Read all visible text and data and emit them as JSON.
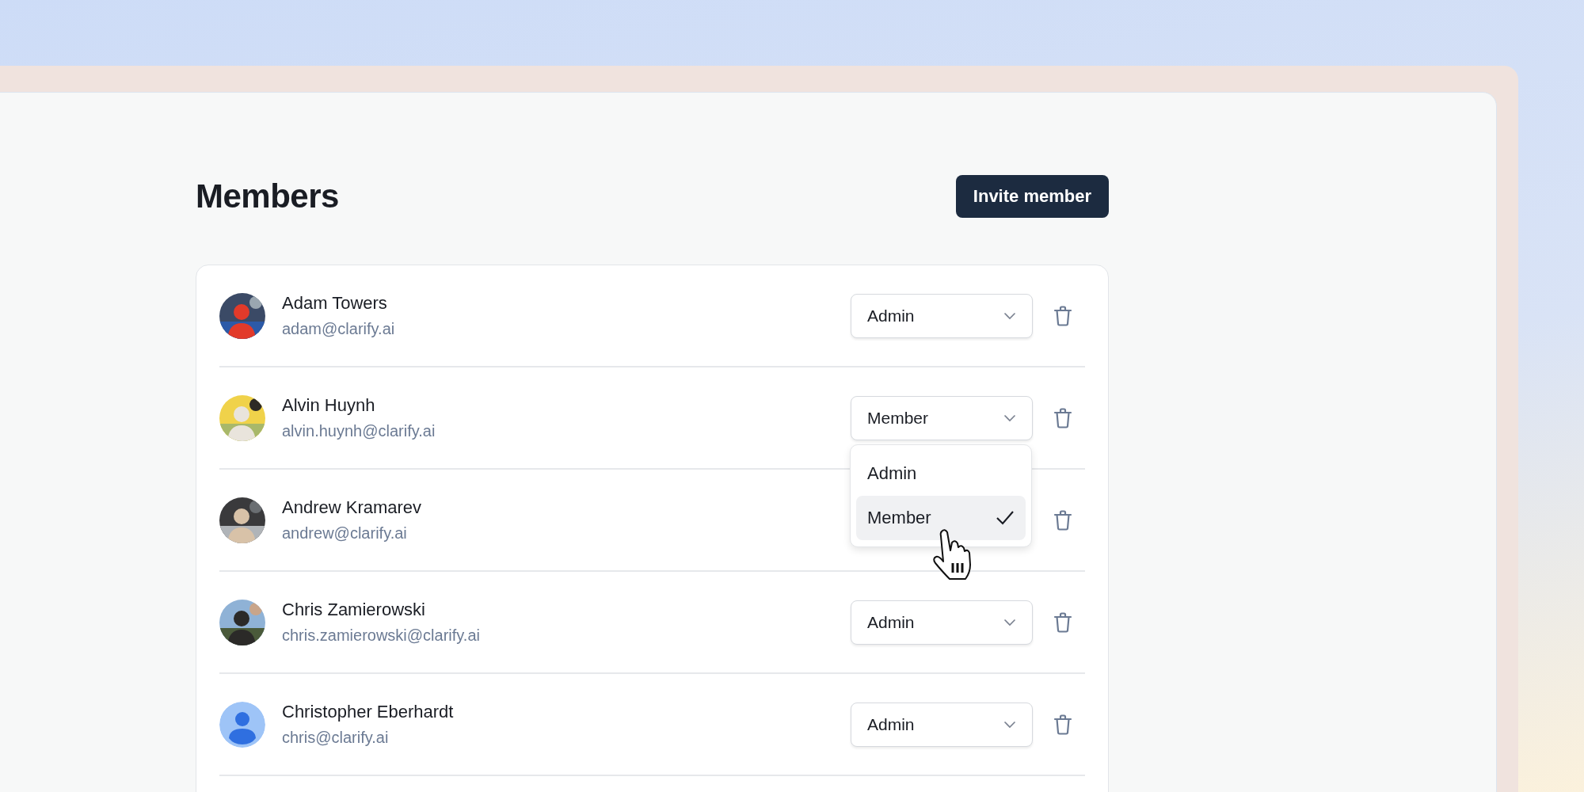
{
  "page": {
    "title": "Members",
    "invite_button": "Invite member"
  },
  "members": [
    {
      "name": "Adam Towers",
      "email": "adam@clarify.ai",
      "role": "Admin"
    },
    {
      "name": "Alvin Huynh",
      "email": "alvin.huynh@clarify.ai",
      "role": "Member",
      "menu": {
        "options": [
          {
            "label": "Admin",
            "selected": false
          },
          {
            "label": "Member",
            "selected": true
          }
        ]
      }
    },
    {
      "name": "Andrew Kramarev",
      "email": "andrew@clarify.ai"
    },
    {
      "name": "Chris Zamierowski",
      "email": "chris.zamierowski@clarify.ai",
      "role": "Admin"
    },
    {
      "name": "Christopher Eberhardt",
      "email": "chris@clarify.ai",
      "role": "Admin",
      "avatar": {
        "kind": "default"
      }
    }
  ]
}
